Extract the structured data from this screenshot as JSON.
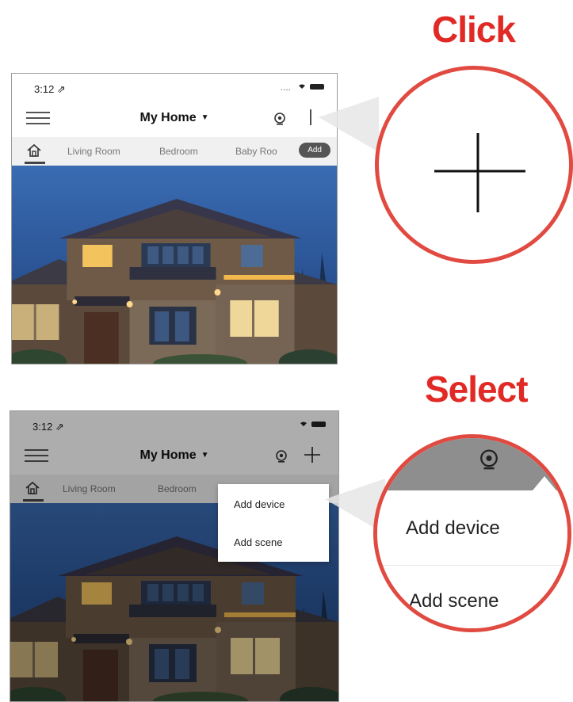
{
  "callouts": {
    "step1_label": "Click",
    "step2_label": "Select"
  },
  "phone1": {
    "status_time": "3:12 ⇗",
    "status_signal": "....",
    "title": "My Home",
    "title_caret": "▼",
    "tabs": [
      "Living Room",
      "Bedroom",
      "Baby Roo"
    ],
    "pill_label": "Add",
    "icons": [
      "menu-icon",
      "camera-icon",
      "home-icon",
      "add-icon"
    ]
  },
  "phone2": {
    "status_time": "3:12 ⇗",
    "title": "My Home",
    "title_caret": "▼",
    "tabs": [
      "Living Room",
      "Bedroom"
    ],
    "menu": {
      "add_device": "Add device",
      "add_scene": "Add scene"
    },
    "icons": [
      "menu-icon",
      "camera-icon",
      "plus-icon",
      "home-icon"
    ]
  },
  "zoom2": {
    "add_device": "Add device",
    "add_scene": "Add scene"
  },
  "colors": {
    "callout_red": "#e12a25",
    "circle_border": "#e14a40",
    "sky": "#2f5d9e",
    "dropdown_bg": "#ffffff"
  }
}
